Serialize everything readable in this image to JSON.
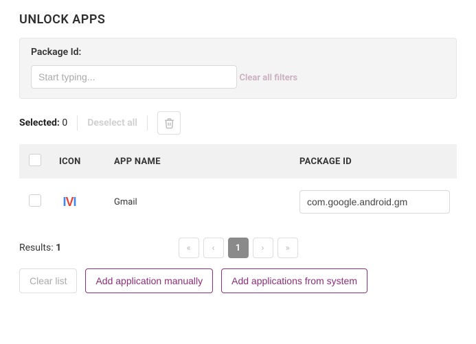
{
  "title": "UNLOCK APPS",
  "filter": {
    "label": "Package Id:",
    "placeholder": "Start typing...",
    "value": "",
    "clear_label": "Clear all filters"
  },
  "selection": {
    "label": "Selected:",
    "count": "0",
    "deselect_label": "Deselect all"
  },
  "columns": {
    "icon": "ICON",
    "name": "APP NAME",
    "pkg": "PACKAGE ID"
  },
  "rows": [
    {
      "icon": "gmail-icon",
      "name": "Gmail",
      "package_id": "com.google.android.gm"
    }
  ],
  "results": {
    "label": "Results:",
    "count": "1"
  },
  "pager": {
    "first": "«",
    "prev": "‹",
    "current": "1",
    "next": "›",
    "last": "»"
  },
  "actions": {
    "clear_list": "Clear list",
    "add_manual": "Add application manually",
    "add_system": "Add applications from system"
  }
}
